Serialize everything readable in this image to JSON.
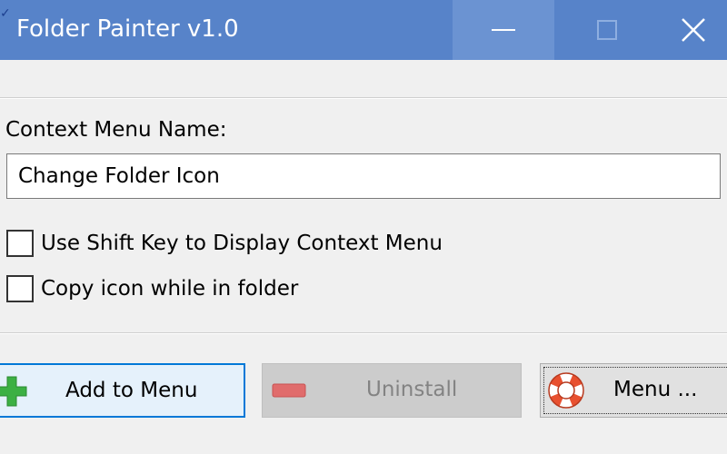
{
  "window": {
    "title": "Folder Painter v1.0",
    "icon": "app-icon",
    "controls": {
      "minimize": "minimize-icon",
      "maximize": "maximize-icon",
      "close": "close-icon"
    }
  },
  "form": {
    "context_menu_label": "Context Menu Name:",
    "context_menu_value": "Change Folder Icon",
    "checkboxes": [
      {
        "label": "Use Shift Key to Display Context Menu",
        "checked": false
      },
      {
        "label": "Copy icon while in folder",
        "checked": false
      }
    ]
  },
  "buttons": {
    "add": {
      "label": "Add to Menu",
      "icon": "plus-icon",
      "icon_color": "#3cb043"
    },
    "uninstall": {
      "label": "Uninstall",
      "icon": "minus-icon",
      "icon_color": "#e06c6c",
      "disabled": true
    },
    "menu": {
      "label": "Menu ...",
      "icon": "lifebuoy-icon",
      "icon_color": "#e8502f"
    }
  },
  "colors": {
    "titlebar": "#5783c9",
    "focus_border": "#0078d7"
  }
}
